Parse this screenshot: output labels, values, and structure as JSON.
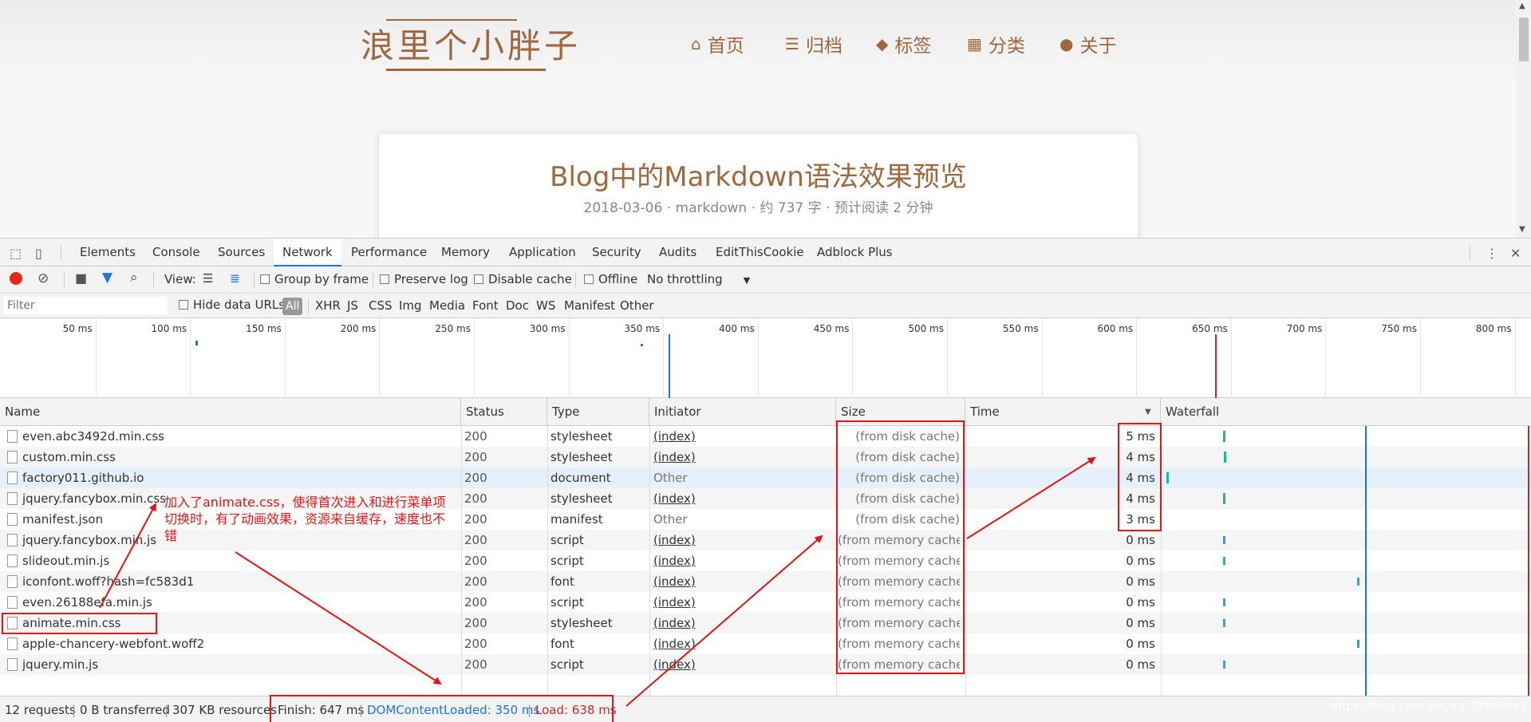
{
  "blog": {
    "logo": "浪里个小胖子",
    "nav": [
      {
        "icon": "home-icon",
        "glyph": "⌂",
        "label": "首页"
      },
      {
        "icon": "archive-icon",
        "glyph": "☰",
        "label": "归档"
      },
      {
        "icon": "tag-icon",
        "glyph": "◆",
        "label": "标签"
      },
      {
        "icon": "grid-icon",
        "glyph": "▦",
        "label": "分类"
      },
      {
        "icon": "user-icon",
        "glyph": "●",
        "label": "关于"
      }
    ],
    "post_title": "Blog中的Markdown语法效果预览",
    "post_meta": "2018-03-06 · markdown · 约 737 字 · 预计阅读 2 分钟"
  },
  "devtools": {
    "tabs": [
      "Elements",
      "Console",
      "Sources",
      "Network",
      "Performance",
      "Memory",
      "Application",
      "Security",
      "Audits",
      "EditThisCookie",
      "Adblock Plus"
    ],
    "active_tab": "Network",
    "toolbar": {
      "view_label": "View:",
      "group_by_frame": "Group by frame",
      "preserve_log": "Preserve log",
      "disable_cache": "Disable cache",
      "offline": "Offline",
      "throttling": "No throttling"
    },
    "filter_bar": {
      "placeholder": "Filter",
      "hide_data_urls": "Hide data URLs",
      "types": [
        "All",
        "XHR",
        "JS",
        "CSS",
        "Img",
        "Media",
        "Font",
        "Doc",
        "WS",
        "Manifest",
        "Other"
      ]
    },
    "overview_ticks": [
      "50 ms",
      "100 ms",
      "150 ms",
      "200 ms",
      "250 ms",
      "300 ms",
      "350 ms",
      "400 ms",
      "450 ms",
      "500 ms",
      "550 ms",
      "600 ms",
      "650 ms",
      "700 ms",
      "750 ms",
      "800 ms"
    ],
    "columns": [
      "Name",
      "Status",
      "Type",
      "Initiator",
      "Size",
      "Time",
      "Waterfall"
    ],
    "rows": [
      {
        "name": "even.abc3492d.min.css",
        "status": "200",
        "type": "stylesheet",
        "initiator": "(index)",
        "size": "(from disk cache)",
        "time": "5 ms"
      },
      {
        "name": "custom.min.css",
        "status": "200",
        "type": "stylesheet",
        "initiator": "(index)",
        "size": "(from disk cache)",
        "time": "4 ms"
      },
      {
        "name": "factory011.github.io",
        "status": "200",
        "type": "document",
        "initiator": "Other",
        "size": "(from disk cache)",
        "time": "4 ms"
      },
      {
        "name": "jquery.fancybox.min.css",
        "status": "200",
        "type": "stylesheet",
        "initiator": "(index)",
        "size": "(from disk cache)",
        "time": "4 ms"
      },
      {
        "name": "manifest.json",
        "status": "200",
        "type": "manifest",
        "initiator": "Other",
        "size": "(from disk cache)",
        "time": "3 ms"
      },
      {
        "name": "jquery.fancybox.min.js",
        "status": "200",
        "type": "script",
        "initiator": "(index)",
        "size": "(from memory cache)",
        "time": "0 ms"
      },
      {
        "name": "slideout.min.js",
        "status": "200",
        "type": "script",
        "initiator": "(index)",
        "size": "(from memory cache)",
        "time": "0 ms"
      },
      {
        "name": "iconfont.woff?hash=fc583d1",
        "status": "200",
        "type": "font",
        "initiator": "(index)",
        "size": "(from memory cache)",
        "time": "0 ms"
      },
      {
        "name": "even.26188efa.min.js",
        "status": "200",
        "type": "script",
        "initiator": "(index)",
        "size": "(from memory cache)",
        "time": "0 ms"
      },
      {
        "name": "animate.min.css",
        "status": "200",
        "type": "stylesheet",
        "initiator": "(index)",
        "size": "(from memory cache)",
        "time": "0 ms"
      },
      {
        "name": "apple-chancery-webfont.woff2",
        "status": "200",
        "type": "font",
        "initiator": "(index)",
        "size": "(from memory cache)",
        "time": "0 ms"
      },
      {
        "name": "jquery.min.js",
        "status": "200",
        "type": "script",
        "initiator": "(index)",
        "size": "(from memory cache)",
        "time": "0 ms"
      }
    ],
    "status_bar": {
      "requests": "12 requests",
      "transferred": "0 B transferred",
      "resources": "307 KB resources",
      "finish": "Finish: 647 ms",
      "dom_content_loaded": "DOMContentLoaded: 350 ms",
      "load": "Load: 638 ms"
    }
  },
  "annotation": "加入了animate.css，使得首次进入和进行菜单项切换时，有了动画效果，资源来自缓存，速度也不错",
  "watermark": "https://blog.csdn.net/qq_37968043",
  "colors": {
    "accent": "#a0673c",
    "annotation": "#e31414",
    "dom_content_loaded": "#1a73e8",
    "load": "#c62828"
  }
}
